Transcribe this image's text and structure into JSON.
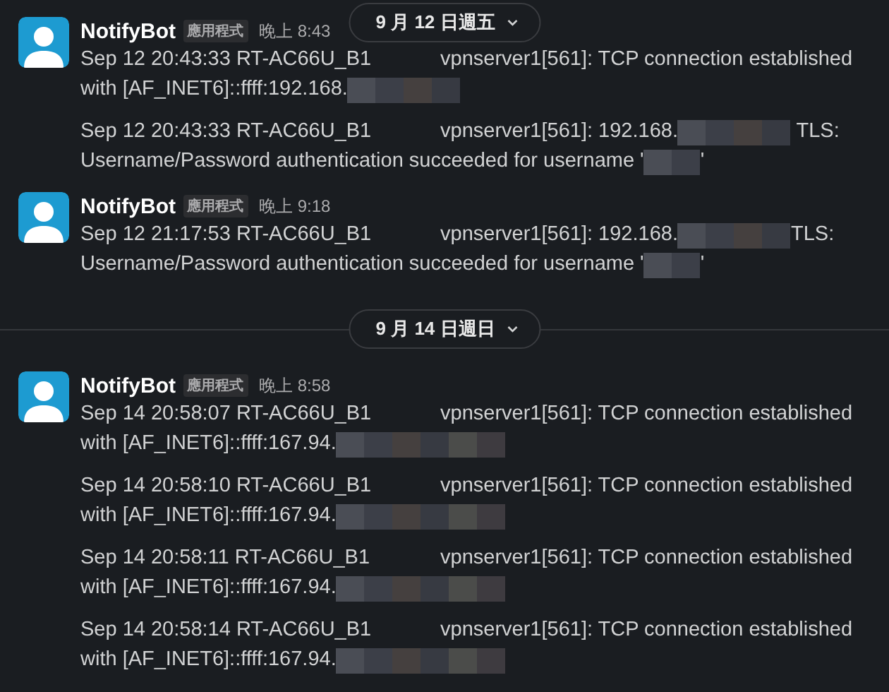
{
  "sticky_date": {
    "label": "9 月 12 日週五"
  },
  "timeline": [
    {
      "kind": "message",
      "sender": "NotifyBot",
      "badge": "應用程式",
      "time": "晚上 8:43",
      "entries": [
        {
          "lines": [
            [
              {
                "kind": "source",
                "text": "Sep 12 20:43:33 RT-AC66U_B1"
              },
              {
                "kind": "text",
                "text": "vpnserver1[561]: TCP connection established"
              }
            ],
            [
              {
                "kind": "text",
                "text": "with [AF_INET6]::ffff:192.168."
              },
              {
                "kind": "redacted-medium"
              }
            ]
          ]
        },
        {
          "lines": [
            [
              {
                "kind": "source",
                "text": "Sep 12 20:43:33 RT-AC66U_B1"
              },
              {
                "kind": "text",
                "text": "vpnserver1[561]: 192.168."
              },
              {
                "kind": "redacted-medium"
              },
              {
                "kind": "text",
                "text": " TLS:"
              }
            ],
            [
              {
                "kind": "text",
                "text": "Username/Password authentication succeeded for username '"
              },
              {
                "kind": "redacted-short"
              },
              {
                "kind": "text",
                "text": "'"
              }
            ]
          ]
        }
      ]
    },
    {
      "kind": "message",
      "sender": "NotifyBot",
      "badge": "應用程式",
      "time": "晚上 9:18",
      "entries": [
        {
          "lines": [
            [
              {
                "kind": "source",
                "text": "Sep 12 21:17:53 RT-AC66U_B1"
              },
              {
                "kind": "text",
                "text": "vpnserver1[561]: 192.168."
              },
              {
                "kind": "redacted-medium"
              },
              {
                "kind": "text",
                "text": "TLS:"
              }
            ],
            [
              {
                "kind": "text",
                "text": "Username/Password authentication succeeded for username '"
              },
              {
                "kind": "redacted-short"
              },
              {
                "kind": "text",
                "text": "'"
              }
            ]
          ]
        }
      ]
    },
    {
      "kind": "divider",
      "label": "9 月 14 日週日"
    },
    {
      "kind": "message",
      "sender": "NotifyBot",
      "badge": "應用程式",
      "time": "晚上 8:58",
      "entries": [
        {
          "lines": [
            [
              {
                "kind": "source",
                "text": "Sep 14 20:58:07 RT-AC66U_B1"
              },
              {
                "kind": "text",
                "text": "vpnserver1[561]: TCP connection established"
              }
            ],
            [
              {
                "kind": "text",
                "text": "with [AF_INET6]::ffff:167.94."
              },
              {
                "kind": "redacted-long"
              }
            ]
          ]
        },
        {
          "lines": [
            [
              {
                "kind": "source",
                "text": "Sep 14 20:58:10 RT-AC66U_B1"
              },
              {
                "kind": "text",
                "text": "vpnserver1[561]: TCP connection established"
              }
            ],
            [
              {
                "kind": "text",
                "text": "with [AF_INET6]::ffff:167.94."
              },
              {
                "kind": "redacted-long"
              }
            ]
          ]
        },
        {
          "lines": [
            [
              {
                "kind": "source",
                "text": "Sep 14 20:58:11 RT-AC66U_B1"
              },
              {
                "kind": "text",
                "text": "vpnserver1[561]: TCP connection established"
              }
            ],
            [
              {
                "kind": "text",
                "text": "with [AF_INET6]::ffff:167.94."
              },
              {
                "kind": "redacted-long"
              }
            ]
          ]
        },
        {
          "lines": [
            [
              {
                "kind": "source",
                "text": "Sep 14 20:58:14 RT-AC66U_B1"
              },
              {
                "kind": "text",
                "text": "vpnserver1[561]: TCP connection established"
              }
            ],
            [
              {
                "kind": "text",
                "text": "with [AF_INET6]::ffff:167.94."
              },
              {
                "kind": "redacted-long"
              }
            ]
          ]
        }
      ]
    }
  ]
}
